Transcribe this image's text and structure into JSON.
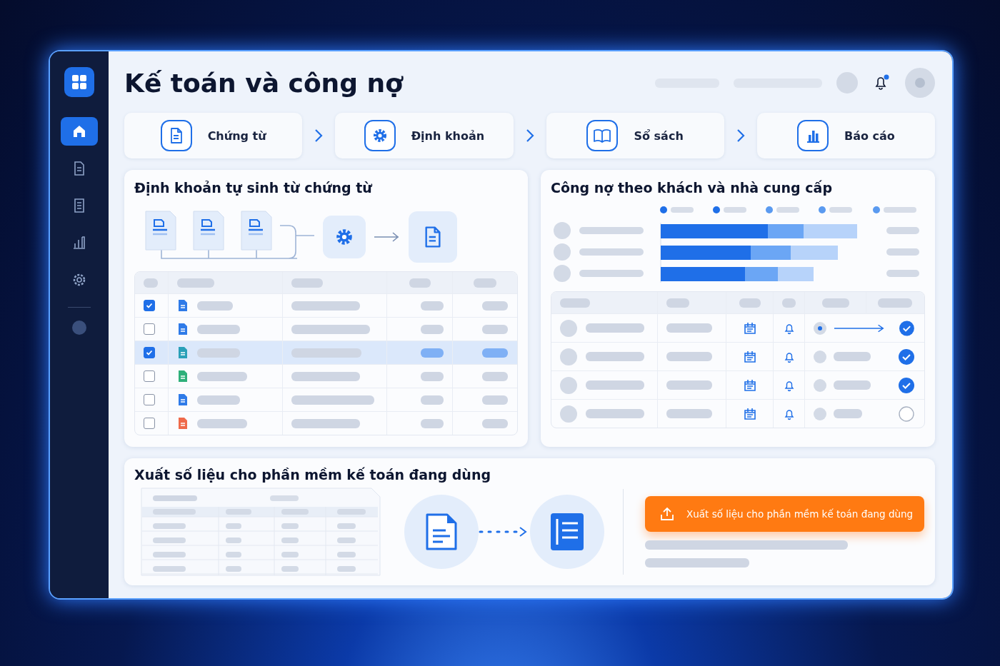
{
  "window": {
    "title": "Kế toán và công nợ"
  },
  "sidebar": {
    "items": [
      {
        "kind": "home",
        "selected": true
      },
      {
        "kind": "document",
        "selected": false
      },
      {
        "kind": "list",
        "selected": false
      },
      {
        "kind": "chart",
        "selected": false
      },
      {
        "kind": "settings",
        "selected": false
      }
    ]
  },
  "steps": [
    {
      "label": "Chứng từ",
      "kind": "document"
    },
    {
      "label": "Định khoản",
      "kind": "settings"
    },
    {
      "label": "Sổ sách",
      "kind": "book"
    },
    {
      "label": "Báo cáo",
      "kind": "chart"
    }
  ],
  "voucher_panel": {
    "title": "Định khoản tự sinh từ chứng từ",
    "rows": [
      {
        "checked": true,
        "selected": false,
        "color": "#2f7be8"
      },
      {
        "checked": false,
        "selected": false,
        "color": "#2f7be8"
      },
      {
        "checked": true,
        "selected": true,
        "color": "#2aa0b8"
      },
      {
        "checked": false,
        "selected": false,
        "color": "#2fb07a"
      },
      {
        "checked": false,
        "selected": false,
        "color": "#2f7be8"
      },
      {
        "checked": false,
        "selected": false,
        "color": "#ef6a4a"
      }
    ]
  },
  "debt_panel": {
    "title": "Công nợ theo khách và nhà cung cấp",
    "rows": [
      {
        "kind": "arrow",
        "checked": true
      },
      {
        "kind": "bar",
        "checked": true
      },
      {
        "kind": "bar",
        "checked": true
      },
      {
        "kind": "bar",
        "checked": false
      }
    ]
  },
  "export_panel": {
    "title": "Xuất số liệu cho phần mềm kế toán đang dùng",
    "button": "Xuất số liệu cho phần mềm kế toán đang dùng"
  }
}
